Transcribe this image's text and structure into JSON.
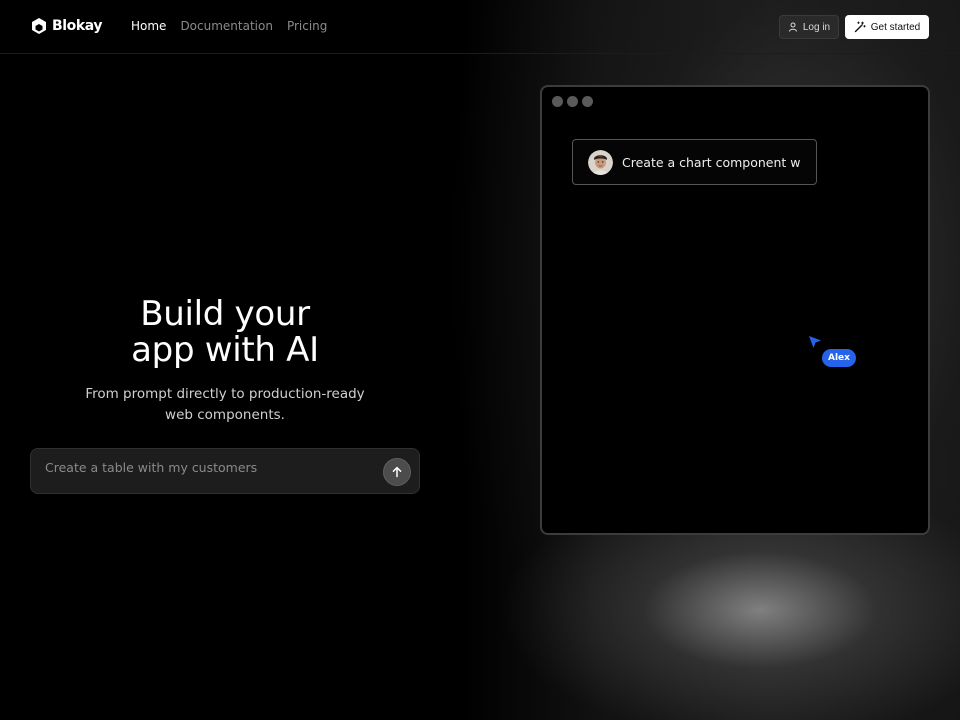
{
  "brand": {
    "name": "Blokay"
  },
  "nav": {
    "items": [
      {
        "label": "Home",
        "active": true
      },
      {
        "label": "Documentation",
        "active": false
      },
      {
        "label": "Pricing",
        "active": false
      }
    ]
  },
  "header_actions": {
    "login_label": "Log in",
    "get_started_label": "Get started"
  },
  "hero": {
    "title_line1": "Build your",
    "title_line2": "app with AI",
    "subtitle_line1": "From prompt directly to production-ready",
    "subtitle_line2": "web components."
  },
  "prompt": {
    "placeholder": "Create a table with my customers",
    "value": ""
  },
  "preview": {
    "chat_message": "Create a chart component w",
    "cursor_user": "Alex"
  },
  "colors": {
    "background": "#000000",
    "accent_cursor": "#2563eb",
    "button_light": "#ffffff",
    "button_dark": "#2a2a2a"
  },
  "icons": {
    "logo": "cube-logo-icon",
    "login": "user-icon",
    "get_started": "magic-wand-icon",
    "send": "arrow-up-icon",
    "cursor": "pointer-cursor-icon"
  }
}
